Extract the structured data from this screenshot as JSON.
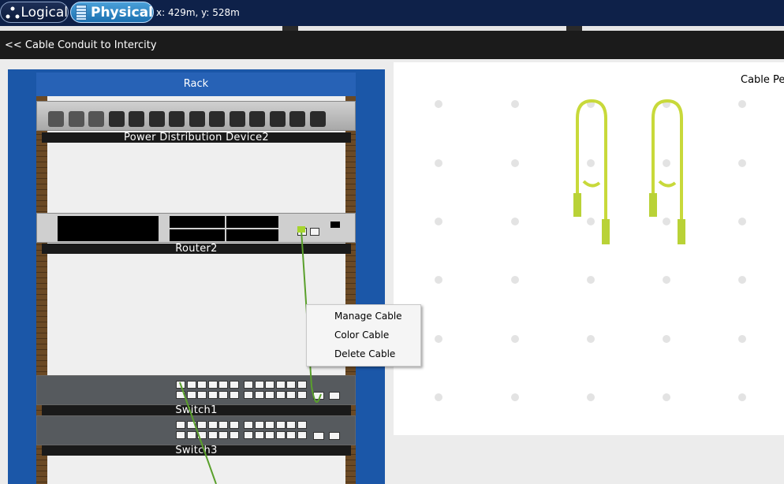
{
  "toolbar": {
    "logical_label": "Logical",
    "physical_label": "Physical",
    "coordinates": "x: 429m, y: 528m"
  },
  "nav": {
    "back_label": "<< Cable Conduit to Intercity"
  },
  "rack": {
    "title": "Rack",
    "devices": [
      {
        "label": "Power Distribution Device2"
      },
      {
        "label": "Router2"
      },
      {
        "label": "Switch1"
      },
      {
        "label": "Switch3"
      }
    ]
  },
  "workspace": {
    "cable_label": "Cable Pe"
  },
  "context_menu": {
    "items": [
      "Manage Cable",
      "Color Cable",
      "Delete Cable"
    ]
  },
  "colors": {
    "cable": "#b9d237",
    "connected_cable": "#5aa02c",
    "rack_blue": "#1b57a8",
    "header_navy": "#0e2149"
  },
  "icons": [
    "logical-network-icon",
    "physical-rack-icon"
  ]
}
